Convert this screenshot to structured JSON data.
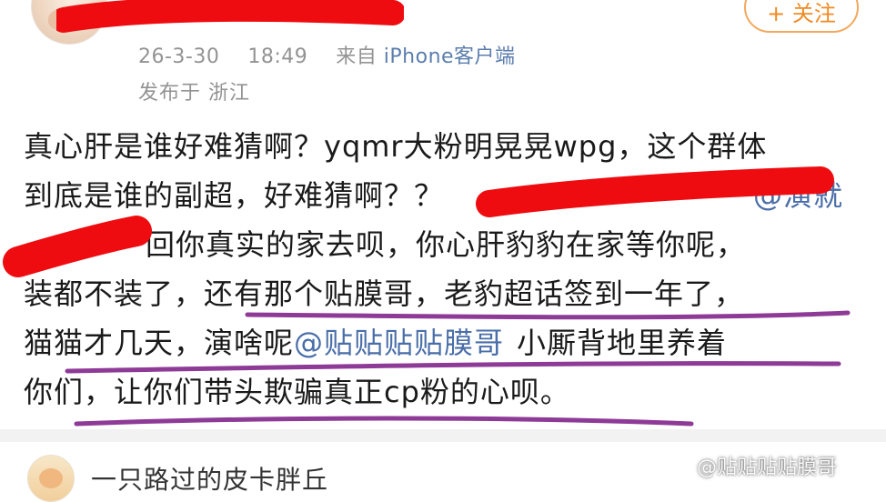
{
  "post": {
    "follow_label": "+ 关注",
    "date": "26-3-30",
    "time": "18:49",
    "source_prefix": "来自",
    "source": "iPhone客户端",
    "location": "发布于  浙江",
    "body": {
      "line1": "真心肝是谁好难猜啊？yqmr大粉明晃晃wpg，这个群体",
      "line2": "到底是谁的副超，好难猜啊？？",
      "line2_mention_tail": "@演",
      "line2_tail": "就",
      "line3_tail": "回你真实的家去呗，你心肝豹豹在家等你呢，",
      "line4": "装都不装了，还有那个贴膜哥，老豹超话签到一年了，",
      "line5_prefix": "猫猫才几天，演啥呢",
      "line5_mention": "@贴贴贴贴膜哥",
      "line5_suffix": "小厮背地里养着",
      "line6": "你们，让你们带头欺骗真正cp粉的心呗。"
    }
  },
  "comment": {
    "name": "一只路过的皮卡胖丘"
  },
  "watermark": {
    "text": "@贴贴贴贴膜哥"
  },
  "annotations": {
    "redaction_color": "#ee0c10",
    "underline_color": "#8e3a97"
  }
}
